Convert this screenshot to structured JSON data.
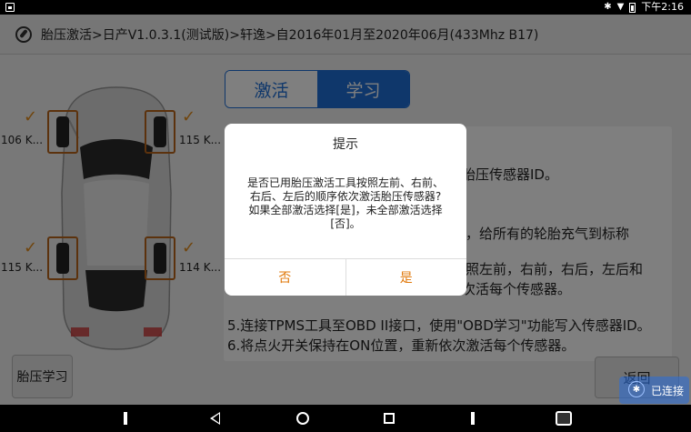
{
  "status_bar": {
    "time": "下午2:16"
  },
  "header": {
    "title": "胎压激活>日产V1.0.3.1(测试版)>轩逸>自2016年01月至2020年06月(433Mhz B17)"
  },
  "tabs": [
    {
      "label": "激活",
      "active": false
    },
    {
      "label": "学习",
      "active": true
    }
  ],
  "tires": {
    "front_left": "106 K...",
    "front_right": "115 K...",
    "rear_left": "115 K...",
    "rear_right": "114 K..."
  },
  "instructions": {
    "line1": "胎压传感器ID。",
    "line2": "，给所有的轮胎充气到标称",
    "line3": "照左前，右前，右后，左后和",
    "line4": "次活每个传感器。",
    "line5": "5.连接TPMS工具至OBD II接口，使用\"OBD学习\"功能写入传感器ID。",
    "line6": "6.将点火开关保持在ON位置，重新依次激活每个传感器。"
  },
  "buttons": {
    "tpms_learn": "胎压学习",
    "back": "返回"
  },
  "connection": {
    "label": "已连接"
  },
  "dialog": {
    "title": "提示",
    "line1": "是否已用胎压激活工具按照左前、右前、",
    "line2": "右后、左后的顺序依次激活胎压传感器?",
    "line3": "如果全部激活选择[是]，未全部激活选择",
    "line4": "[否]。",
    "no": "否",
    "yes": "是"
  },
  "colors": {
    "accent": "#1f6fd6",
    "dialog_button": "#e0780a",
    "check": "#e08a1a"
  }
}
